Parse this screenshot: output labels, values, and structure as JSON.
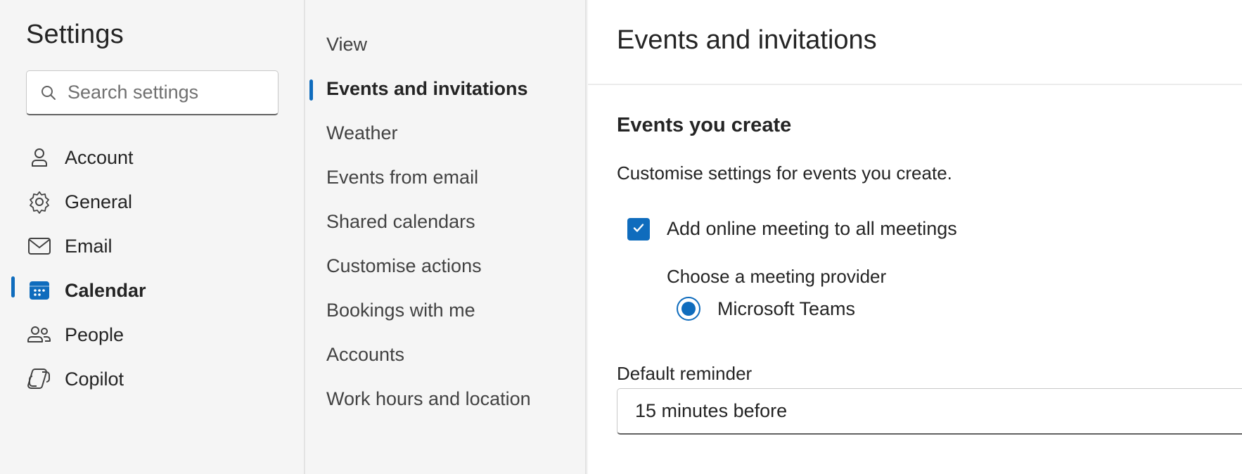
{
  "settings": {
    "title": "Settings",
    "search_placeholder": "Search settings"
  },
  "nav": {
    "items": [
      {
        "label": "Account",
        "icon": "person-icon"
      },
      {
        "label": "General",
        "icon": "gear-icon"
      },
      {
        "label": "Email",
        "icon": "mail-icon"
      },
      {
        "label": "Calendar",
        "icon": "calendar-icon",
        "active": true
      },
      {
        "label": "People",
        "icon": "people-icon"
      },
      {
        "label": "Copilot",
        "icon": "copilot-icon"
      }
    ]
  },
  "subnav": {
    "items": [
      {
        "label": "View"
      },
      {
        "label": "Events and invitations",
        "active": true
      },
      {
        "label": "Weather"
      },
      {
        "label": "Events from email"
      },
      {
        "label": "Shared calendars"
      },
      {
        "label": "Customise actions"
      },
      {
        "label": "Bookings with me"
      },
      {
        "label": "Accounts"
      },
      {
        "label": "Work hours and location"
      }
    ]
  },
  "content": {
    "title": "Events and invitations",
    "section_heading": "Events you create",
    "section_description": "Customise settings for events you create.",
    "online_meeting": {
      "label": "Add online meeting to all meetings",
      "checked": true
    },
    "provider": {
      "label": "Choose a meeting provider",
      "option": "Microsoft Teams",
      "selected": true
    },
    "reminder": {
      "label": "Default reminder",
      "value": "15 minutes before"
    }
  },
  "colors": {
    "accent": "#0f6cbd",
    "sidebar_bg": "#f5f5f5",
    "content_bg": "#ffffff"
  }
}
